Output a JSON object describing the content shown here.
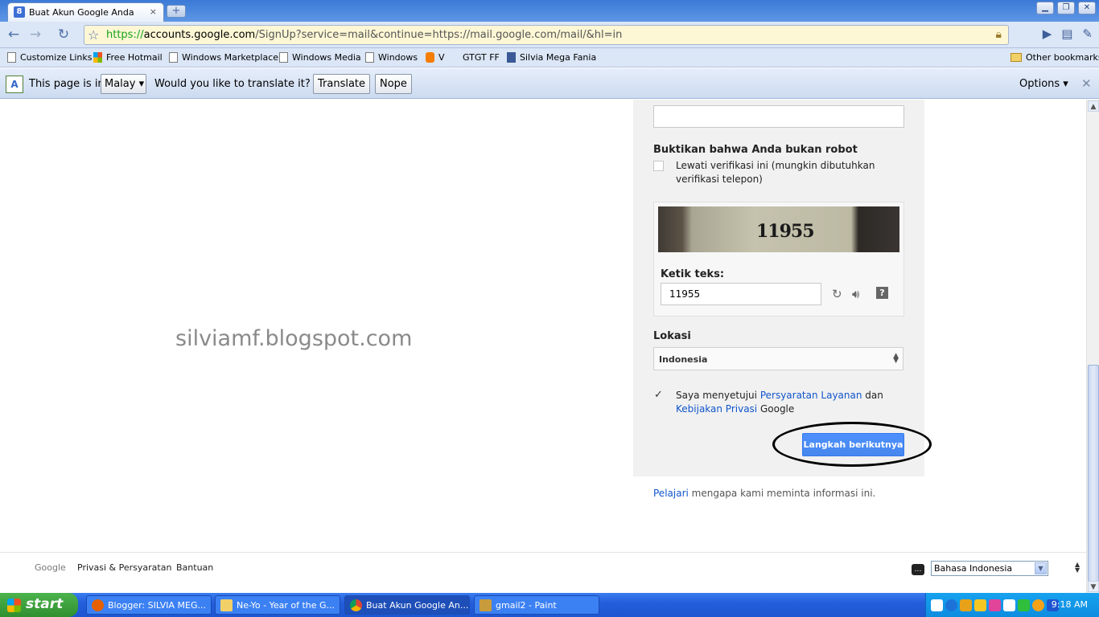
{
  "browser": {
    "tab_title": "Buat Akun Google Anda",
    "tab_close": "×",
    "new_tab": "+",
    "url_scheme": "https://",
    "url_host": "accounts.google.com",
    "url_path": "/SignUp?service=mail&continue=https://mail.google.com/mail/&hl=in"
  },
  "bookmarks": [
    {
      "label": "Customize Links",
      "icon": "page-icon"
    },
    {
      "label": "Free Hotmail",
      "icon": "windows-icon"
    },
    {
      "label": "Windows Marketplace",
      "icon": "page-icon"
    },
    {
      "label": "Windows Media",
      "icon": "page-icon"
    },
    {
      "label": "Windows",
      "icon": "page-icon"
    },
    {
      "label": "V",
      "icon": "blogger-icon"
    },
    {
      "label": "GTGT FF",
      "icon": "none"
    },
    {
      "label": "Silvia Mega Fania",
      "icon": "facebook-icon"
    }
  ],
  "bookmarks_other": "Other bookmarks",
  "translate": {
    "prefix": "This page is in",
    "language": "Malay",
    "question": "Would you like to translate it?",
    "translate_btn": "Translate",
    "nope_btn": "Nope",
    "options": "Options ▾",
    "close": "✕"
  },
  "page": {
    "watermark": "silviamf.blogspot.com",
    "robot_title": "Buktikan bahwa Anda bukan robot",
    "skip_verify_line1": "Lewati verifikasi ini (mungkin dibutuhkan",
    "skip_verify_line2": "verifikasi telepon)",
    "captcha_image_text": "11955",
    "captcha_label": "Ketik teks:",
    "captcha_value": "11955",
    "location_label": "Lokasi",
    "location_value": "Indonesia",
    "agree_prefix": "Saya menyetujui ",
    "agree_tos": "Persyaratan Layanan",
    "agree_and": " dan",
    "agree_privacy": "Kebijakan Privasi",
    "agree_suffix": " Google",
    "next_button": "Langkah berikutnya",
    "why_link": "Pelajari",
    "why_text": " mengapa kami meminta informasi ini."
  },
  "footer": {
    "google": "Google",
    "privacy": "Privasi & Persyaratan",
    "help": "Bantuan",
    "language": "Bahasa Indonesia"
  },
  "taskbar": {
    "start": "start",
    "tasks": [
      {
        "label": "Blogger: SILVIA MEG...",
        "active": false
      },
      {
        "label": "Ne-Yo - Year of the G...",
        "active": false
      },
      {
        "label": "Buat Akun Google An...",
        "active": true
      },
      {
        "label": "gmail2 - Paint",
        "active": false
      }
    ],
    "clock": "9:18 AM"
  },
  "colors": {
    "link": "#1155cc",
    "primary_button": "#4d90fe",
    "url_green": "#16a31a"
  }
}
